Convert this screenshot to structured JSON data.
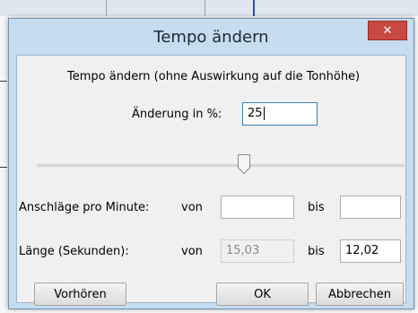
{
  "dialog": {
    "title": "Tempo ändern",
    "close_label": "✕",
    "description": "Tempo ändern (ohne Auswirkung auf die Tonhöhe)",
    "change_label": "Änderung in %:",
    "change_value": "25",
    "slider_value_percent": 25,
    "bpm_label": "Anschläge pro Minute:",
    "bpm_from_label": "von",
    "bpm_from_value": "",
    "bpm_to_label": "bis",
    "bpm_to_value": "",
    "length_label": "Länge (Sekunden):",
    "length_from_label": "von",
    "length_from_value": "15,03",
    "length_to_label": "bis",
    "length_to_value": "12,02",
    "preview_button": "Vorhören",
    "ok_button": "OK",
    "cancel_button": "Abbrechen"
  },
  "colors": {
    "frame": "#c6dcf0",
    "close": "#c74a42",
    "client": "#f0f0f0"
  }
}
